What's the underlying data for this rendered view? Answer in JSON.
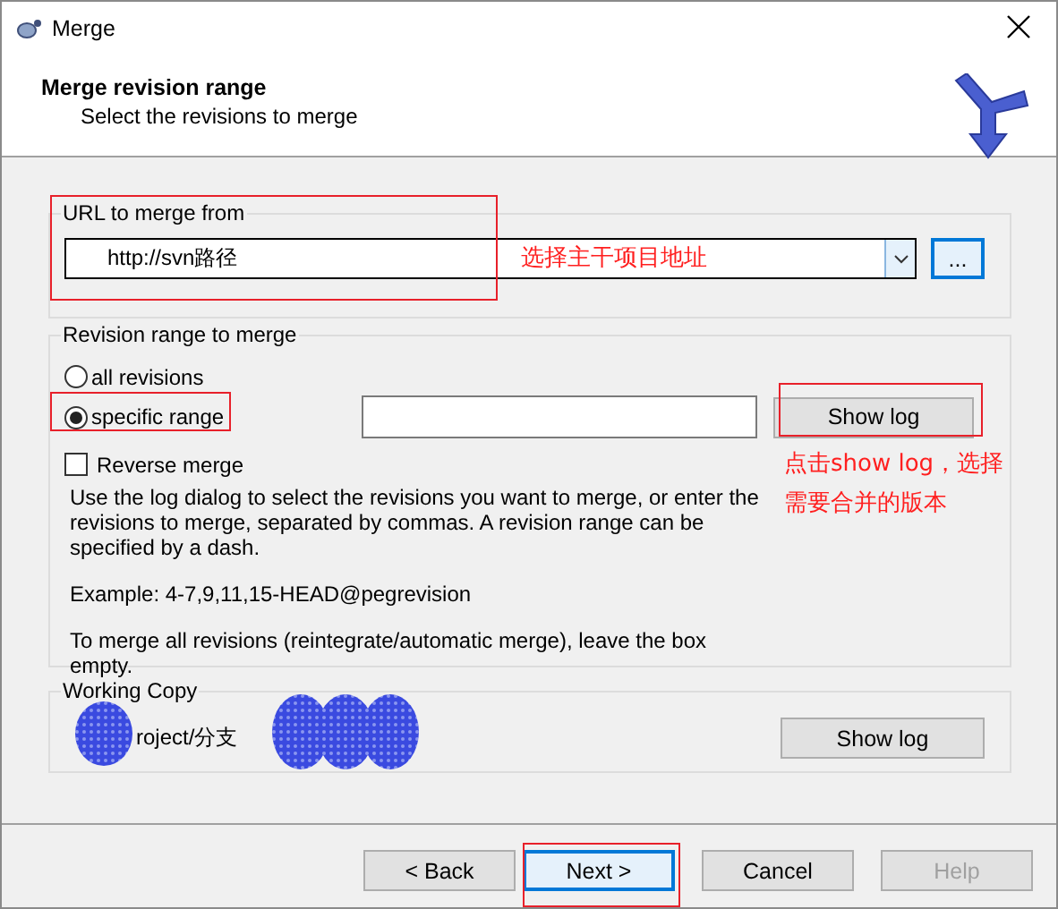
{
  "window": {
    "title": "Merge"
  },
  "header": {
    "title": "Merge revision range",
    "subtitle": "Select the revisions to merge"
  },
  "url_group": {
    "label": "URL to merge from",
    "url": "http://svn路径",
    "browse_button": "..."
  },
  "revision_group": {
    "label": "Revision range to merge",
    "options": [
      {
        "label": "all revisions",
        "selected": false
      },
      {
        "label": "specific range",
        "selected": true
      }
    ],
    "show_log_button": "Show log",
    "reverse_merge": {
      "label": "Reverse merge",
      "checked": false
    },
    "help_text": [
      "Use the log dialog to select the revisions you want to merge, or enter the revisions to merge, separated by commas. A revision range can be specified by a dash.",
      "Example: 4-7,9,11,15-HEAD@pegrevision",
      "To merge all revisions (reintegrate/automatic merge), leave the box empty."
    ]
  },
  "working_copy": {
    "label": "Working Copy",
    "path": "roject/分支",
    "show_log_button": "Show log"
  },
  "buttons": [
    {
      "label": "< Back",
      "focused": false,
      "disabled": false
    },
    {
      "label": "Next >",
      "focused": true,
      "disabled": false
    },
    {
      "label": "Cancel",
      "focused": false,
      "disabled": false
    },
    {
      "label": "Help",
      "focused": false,
      "disabled": true
    }
  ],
  "annotations": [
    {
      "text": "选择主干项目地址"
    },
    {
      "text": "点击show log，选择需要合并的版本"
    }
  ]
}
